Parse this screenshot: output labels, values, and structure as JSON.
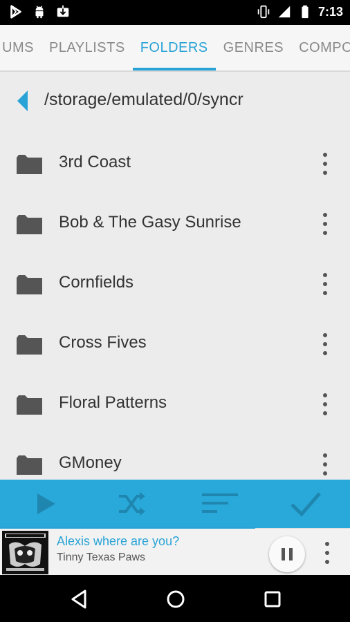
{
  "status_bar": {
    "time": "7:13",
    "left_icons": [
      "play-store-icon",
      "android-icon",
      "download-icon"
    ],
    "right_icons": [
      "vibrate-icon",
      "signal-icon",
      "battery-icon"
    ]
  },
  "tabs": {
    "items": [
      {
        "label": "UMS",
        "active": false
      },
      {
        "label": "PLAYLISTS",
        "active": false
      },
      {
        "label": "FOLDERS",
        "active": true
      },
      {
        "label": "GENRES",
        "active": false
      },
      {
        "label": "COMPO",
        "active": false
      }
    ],
    "accent_color": "#29a3d6"
  },
  "path_bar": {
    "path": "/storage/emulated/0/syncr",
    "back_icon": "back-arrow-icon"
  },
  "folders": [
    {
      "name": "3rd Coast"
    },
    {
      "name": "Bob & The Gasy Sunrise"
    },
    {
      "name": "Cornfields"
    },
    {
      "name": "Cross Fives"
    },
    {
      "name": "Floral Patterns"
    },
    {
      "name": "GMoney"
    }
  ],
  "action_bar": {
    "color": "#29a9d9",
    "buttons": [
      "play-icon",
      "shuffle-icon",
      "sort-icon",
      "checkmark-icon"
    ]
  },
  "now_playing": {
    "title": "Alexis where are you?",
    "artist": "Tinny Texas Paws",
    "progress": 0.73
  },
  "nav_bar": {
    "buttons": [
      "back-icon",
      "home-icon",
      "recents-icon"
    ]
  }
}
